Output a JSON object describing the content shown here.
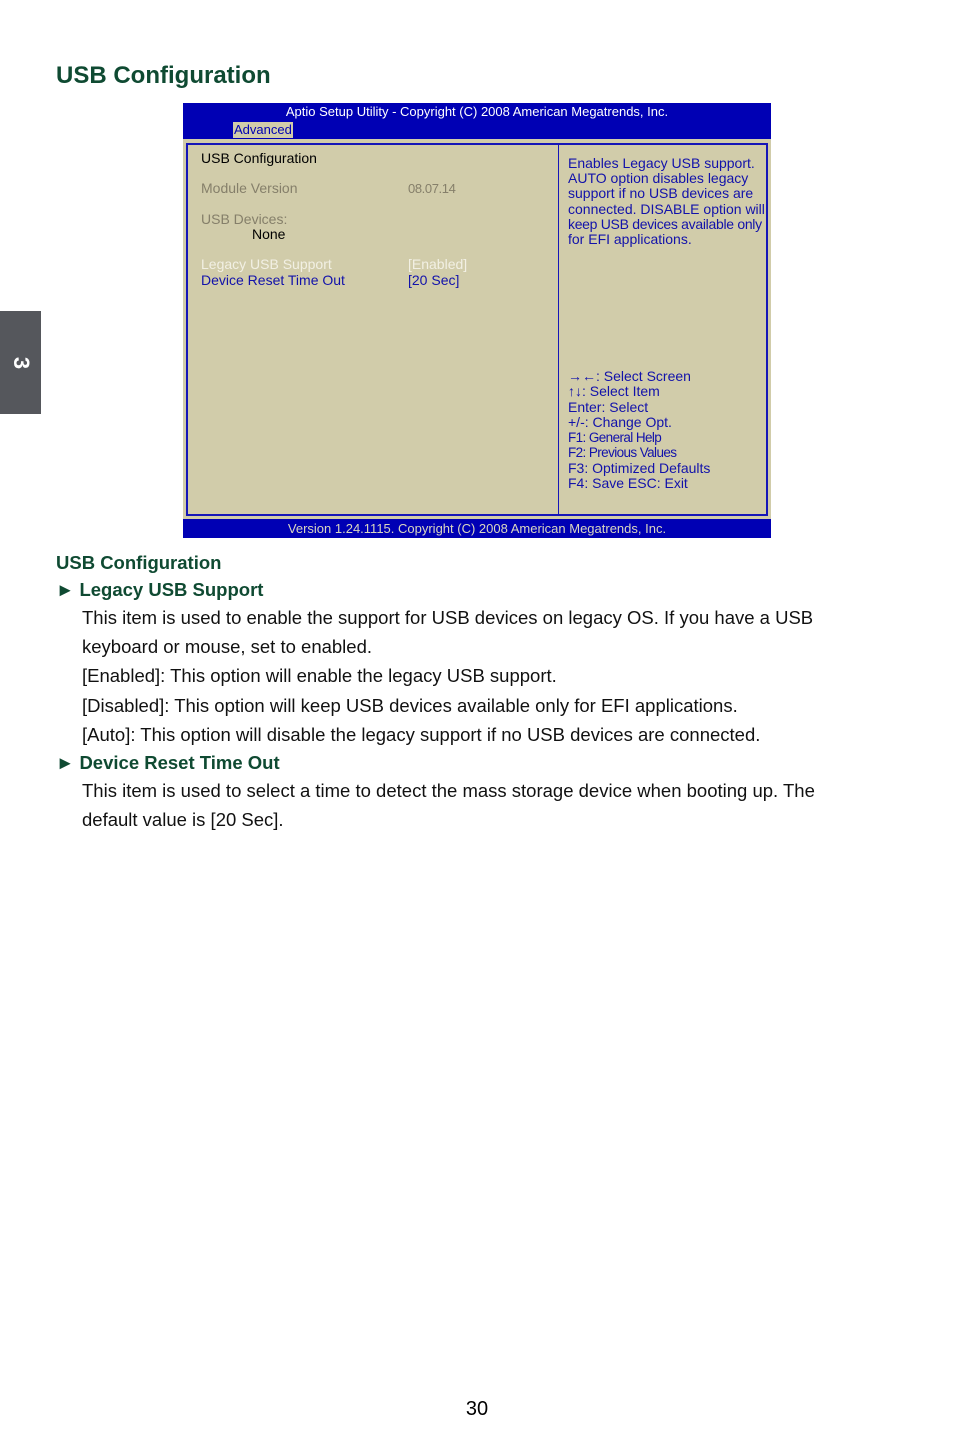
{
  "page_title": "USB Configuration",
  "chapter_tab": "3",
  "bios": {
    "header_title": "Aptio Setup Utility - Copyright (C) 2008 American Megatrends, Inc.",
    "active_tab": "Advanced",
    "screen_title": "USB Configuration",
    "module_version_label": "Module Version",
    "module_version_value": "08.07.14",
    "usb_devices_label": "USB Devices:",
    "usb_devices_value": "None",
    "settings": [
      {
        "label": "Legacy USB Support",
        "value": "[Enabled]",
        "selected": true
      },
      {
        "label": "Device Reset Time Out",
        "value": "[20 Sec]",
        "selected": false
      }
    ],
    "help_lines": [
      "Enables Legacy USB support.",
      "AUTO option disables legacy",
      "support if no USB devices are",
      "connected. DISABLE option will",
      "keep USB devices available only",
      "for EFI applications."
    ],
    "keys": [
      "→←: Select Screen",
      "↑↓: Select Item",
      "Enter: Select",
      "+/-: Change Opt.",
      "F1:  General Help",
      "F2:  Previous Values",
      "F3: Optimized Defaults",
      "F4: Save  ESC: Exit"
    ],
    "footer": "Version 1.24.1115. Copyright (C) 2008 American Megatrends, Inc."
  },
  "section": {
    "title": "USB Configuration",
    "items": [
      {
        "title": "► Legacy USB Support",
        "paragraphs": [
          "This item is used to enable the support for USB devices on legacy OS. If you have a USB",
          "keyboard or mouse, set to enabled.",
          "[Enabled]: This option will enable the legacy USB support.",
          "[Disabled]: This option will keep USB devices available only for EFI applications.",
          "[Auto]: This option will disable the legacy support if no USB devices are connected."
        ]
      },
      {
        "title": "► Device Reset Time Out",
        "paragraphs": [
          "This item is used to select a time to detect the mass storage device when booting up. The",
          "default value is [20 Sec]."
        ]
      }
    ]
  },
  "page_number": "30",
  "colors": {
    "heading_green": "#0f4a32",
    "bios_blue": "#0000b4",
    "bios_panel": "#d1ccaa",
    "chapter_tab_gray": "#55575c"
  }
}
